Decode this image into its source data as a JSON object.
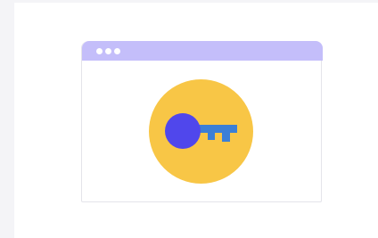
{
  "colors": {
    "page_background": "#f4f4f7",
    "card_background": "#ffffff",
    "title_bar": "#c4befa",
    "window_dots": "#ffffff",
    "circle_background": "#f8c646",
    "key_head": "#5047ec",
    "key_shaft": "#3b7fd6"
  },
  "icons": {
    "window_controls": "three-dots-icon",
    "illustration": "key-icon"
  }
}
